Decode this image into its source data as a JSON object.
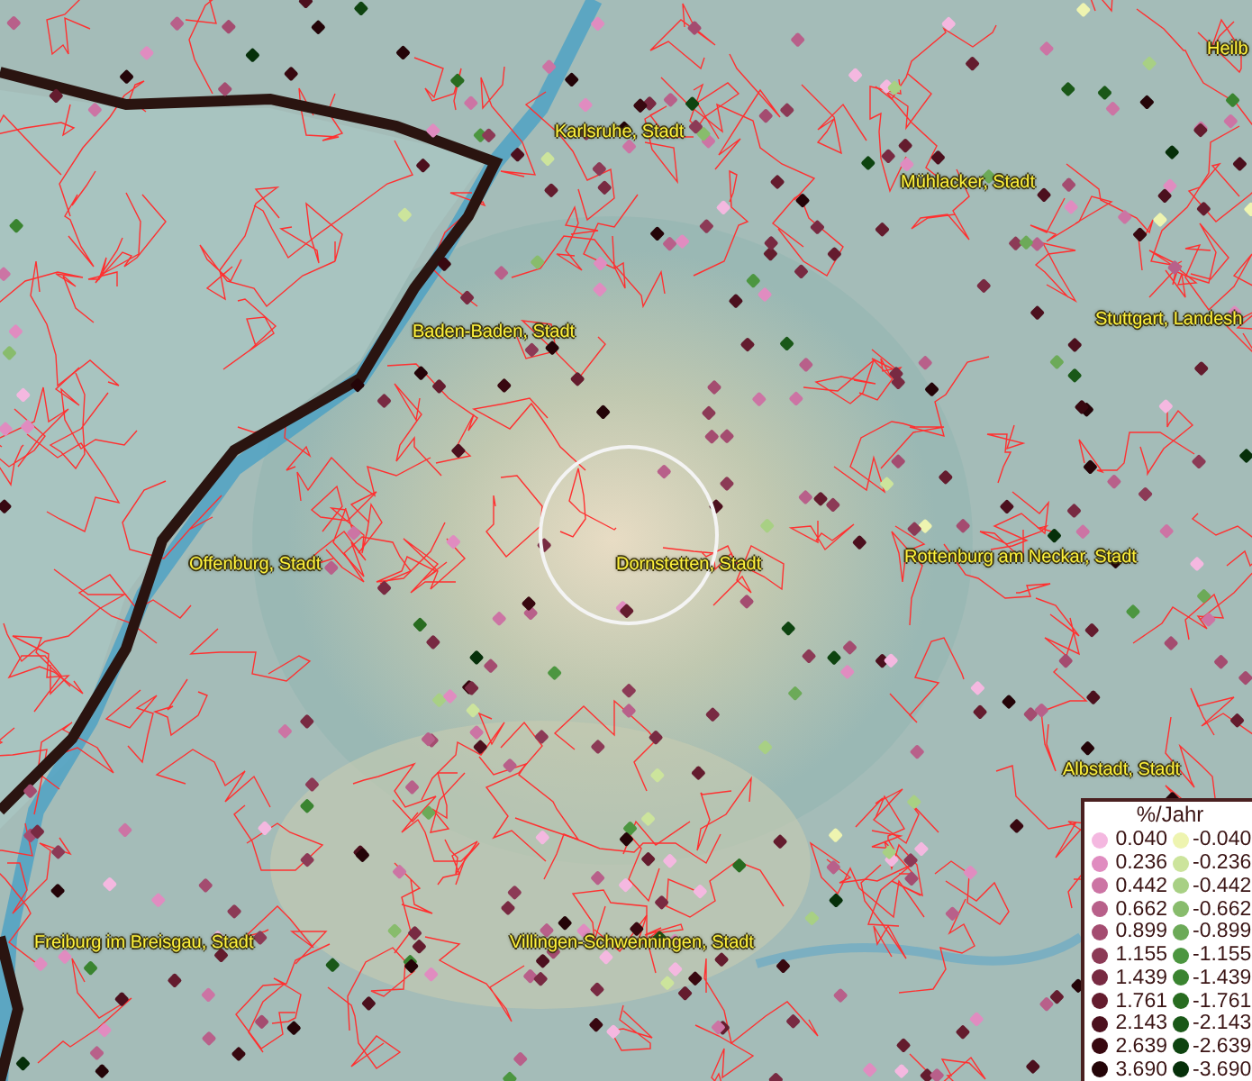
{
  "map": {
    "place_labels": [
      {
        "text": "Heilb"
      },
      {
        "text": "Karlsruhe, Stadt"
      },
      {
        "text": "Mühlacker, Stadt"
      },
      {
        "text": "Stuttgart, Landesh"
      },
      {
        "text": "Baden-Baden, Stadt"
      },
      {
        "text": "Offenburg, Stadt"
      },
      {
        "text": "Dornstetten, Stadt"
      },
      {
        "text": "Rottenburg am Neckar, Stadt"
      },
      {
        "text": "Albstadt, Stadt"
      },
      {
        "text": "Freiburg im Breisgau, Stadt"
      },
      {
        "text": "Villingen-Schwenningen, Stadt"
      }
    ]
  },
  "legend": {
    "title": "%/Jahr",
    "rows": [
      {
        "positive": {
          "label": "0.040",
          "color": "#f4b8e0"
        },
        "negative": {
          "label": "-0.040",
          "color": "#eef4b0"
        }
      },
      {
        "positive": {
          "label": "0.236",
          "color": "#e08cc0"
        },
        "negative": {
          "label": "-0.236",
          "color": "#cce49c"
        }
      },
      {
        "positive": {
          "label": "0.442",
          "color": "#cc74a4"
        },
        "negative": {
          "label": "-0.442",
          "color": "#a8d084"
        }
      },
      {
        "positive": {
          "label": "0.662",
          "color": "#b8608a"
        },
        "negative": {
          "label": "-0.662",
          "color": "#88bc6c"
        }
      },
      {
        "positive": {
          "label": "0.899",
          "color": "#a44c70"
        },
        "negative": {
          "label": "-0.899",
          "color": "#6caa58"
        }
      },
      {
        "positive": {
          "label": "1.155",
          "color": "#8c3a56"
        },
        "negative": {
          "label": "-1.155",
          "color": "#4c9640"
        }
      },
      {
        "positive": {
          "label": "1.439",
          "color": "#782a42"
        },
        "negative": {
          "label": "-1.439",
          "color": "#3a8430"
        }
      },
      {
        "positive": {
          "label": "1.761",
          "color": "#641c2e"
        },
        "negative": {
          "label": "-1.761",
          "color": "#286c20"
        }
      },
      {
        "positive": {
          "label": "2.143",
          "color": "#4c101e"
        },
        "negative": {
          "label": "-2.143",
          "color": "#1a5818"
        }
      },
      {
        "positive": {
          "label": "2.639",
          "color": "#380810"
        },
        "negative": {
          "label": "-2.639",
          "color": "#0e4410"
        }
      },
      {
        "positive": {
          "label": "3.690",
          "color": "#240408"
        },
        "negative": {
          "label": "-3.690",
          "color": "#06300a"
        }
      }
    ]
  }
}
